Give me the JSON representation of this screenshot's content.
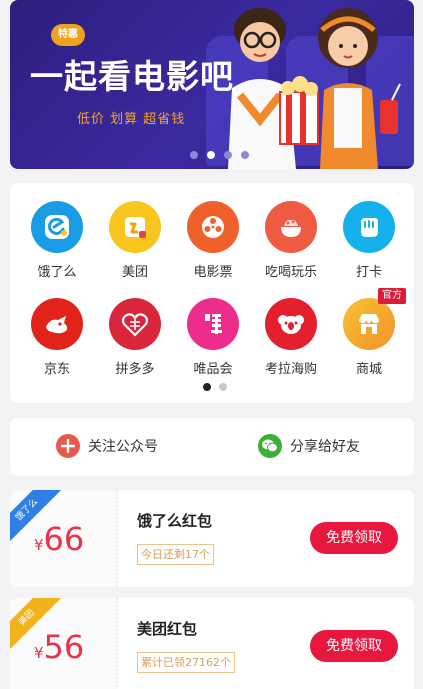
{
  "banner": {
    "tag": "特惠",
    "title": "一起看电影吧",
    "subtitle": "低价 划算 超省钱",
    "dots": 4,
    "active_dot": 1
  },
  "grid": {
    "items": [
      {
        "label": "饿了么",
        "icon": "eleme-icon",
        "color": "#1a9be6"
      },
      {
        "label": "美团",
        "icon": "meituan-icon",
        "color": "#f7c51d"
      },
      {
        "label": "电影票",
        "icon": "film-reel-icon",
        "color": "#f0602a"
      },
      {
        "label": "吃喝玩乐",
        "icon": "food-bowl-icon",
        "color": "#ef5a43"
      },
      {
        "label": "打卡",
        "icon": "fist-icon",
        "color": "#16b1ec"
      },
      {
        "label": "京东",
        "icon": "jd-dog-icon",
        "color": "#e2231a"
      },
      {
        "label": "拼多多",
        "icon": "pinduoduo-icon",
        "color": "#d9263a"
      },
      {
        "label": "唯品会",
        "icon": "vip-icon",
        "color": "#ec2d8c"
      },
      {
        "label": "考拉海购",
        "icon": "koala-icon",
        "color": "#e4202e"
      },
      {
        "label": "商城",
        "icon": "store-icon",
        "color": "#f6a72a",
        "badge": "官方"
      }
    ],
    "page_dots": 2,
    "active_page": 0
  },
  "actions": {
    "follow": {
      "label": "关注公众号",
      "icon": "plus-circle-icon",
      "color": "#e65a4d"
    },
    "share": {
      "label": "分享给好友",
      "icon": "wechat-icon",
      "color": "#3cb034"
    }
  },
  "coupons": [
    {
      "corner": "饿了么",
      "corner_color": "#2f7fe6",
      "currency": "¥",
      "amount": "66",
      "name": "饿了么红包",
      "note": "今日还剩17个",
      "button": "免费领取"
    },
    {
      "corner": "美团",
      "corner_color": "#f2b21c",
      "currency": "¥",
      "amount": "56",
      "name": "美团红包",
      "note": "累计已领27162个",
      "button": "免费领取"
    }
  ]
}
